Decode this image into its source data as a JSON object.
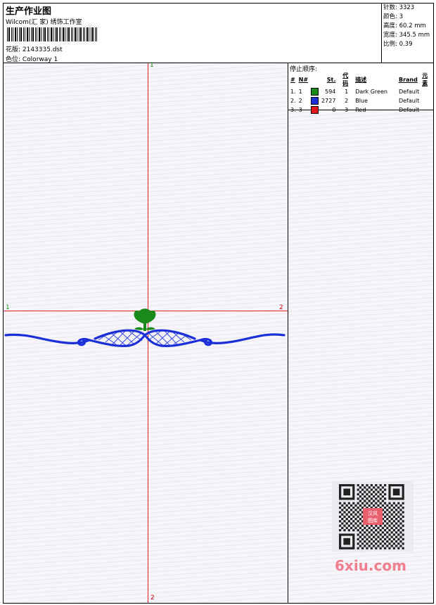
{
  "header": {
    "title": "生产作业图",
    "company": "Wilcom(汇 家) 绣饰工作室",
    "design": "花版: 2143335.dst",
    "colorway": "色位: Colorway 1"
  },
  "stats": {
    "stitches": "针数: 3323",
    "colors": "颜色: 3",
    "height": "高度: 60.2 mm",
    "width": "宽度: 345.5 mm",
    "scale": "比例: 0.39"
  },
  "markers": {
    "top": "1",
    "bottom": "2",
    "left": "1",
    "right": "2"
  },
  "stop_sequence": {
    "title": "停止顺序:",
    "headers": [
      "#",
      "N#",
      "St.",
      "代码",
      "描述",
      "Brand",
      "元素"
    ],
    "rows": [
      {
        "idx": "1.",
        "n": "1",
        "color": "#1a8a1a",
        "st": "594",
        "code": "1",
        "desc": "Dark Green",
        "brand": "Default"
      },
      {
        "idx": "2.",
        "n": "2",
        "color": "#1a2fd8",
        "st": "2727",
        "code": "2",
        "desc": "Blue",
        "brand": "Default"
      },
      {
        "idx": "3.",
        "n": "3",
        "color": "#e01818",
        "st": "0",
        "code": "3",
        "desc": "Red",
        "brand": "Default"
      }
    ]
  },
  "watermark": {
    "stamp": "汉风图库",
    "site": "6xiu.com"
  },
  "colors": {
    "guide": "#e02020",
    "flower": "#1a8a1a",
    "border": "#1a2fd8"
  }
}
